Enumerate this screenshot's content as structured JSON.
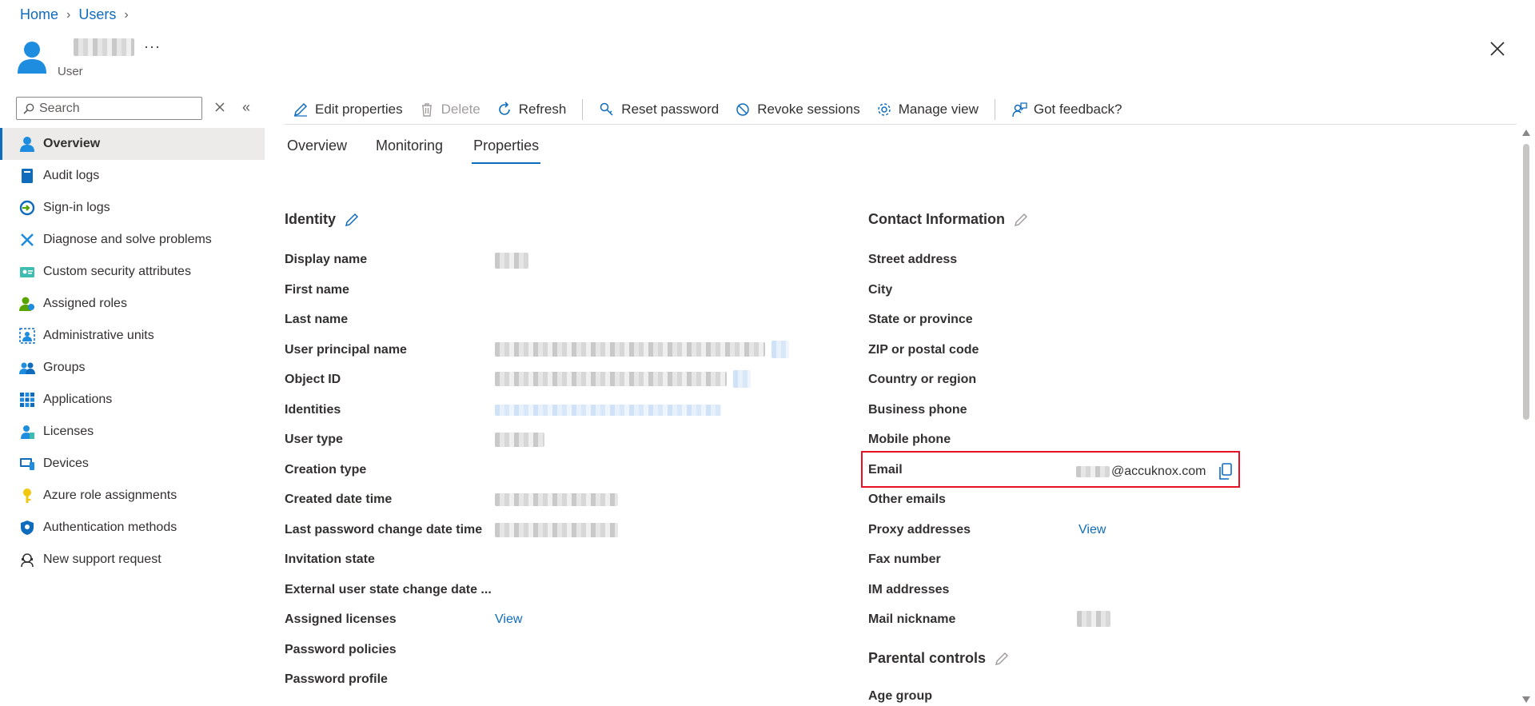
{
  "breadcrumb": {
    "home": "Home",
    "users": "Users"
  },
  "header": {
    "subtitle": "User",
    "more": "···"
  },
  "sidebar": {
    "search_placeholder": "Search",
    "collapse": "«",
    "items": [
      {
        "label": "Overview",
        "icon": "user-icon",
        "active": true
      },
      {
        "label": "Audit logs",
        "icon": "book-icon"
      },
      {
        "label": "Sign-in logs",
        "icon": "sign-in-icon"
      },
      {
        "label": "Diagnose and solve problems",
        "icon": "wrench-icon"
      },
      {
        "label": "Custom security attributes",
        "icon": "attributes-icon"
      },
      {
        "label": "Assigned roles",
        "icon": "roles-icon"
      },
      {
        "label": "Administrative units",
        "icon": "admin-units-icon"
      },
      {
        "label": "Groups",
        "icon": "groups-icon"
      },
      {
        "label": "Applications",
        "icon": "apps-grid-icon"
      },
      {
        "label": "Licenses",
        "icon": "license-icon"
      },
      {
        "label": "Devices",
        "icon": "devices-icon"
      },
      {
        "label": "Azure role assignments",
        "icon": "key-icon"
      },
      {
        "label": "Authentication methods",
        "icon": "shield-icon"
      },
      {
        "label": "New support request",
        "icon": "support-icon"
      }
    ]
  },
  "toolbar": {
    "edit": "Edit properties",
    "delete": "Delete",
    "refresh": "Refresh",
    "reset_password": "Reset password",
    "revoke_sessions": "Revoke sessions",
    "manage_view": "Manage view",
    "feedback": "Got feedback?"
  },
  "tabs": {
    "overview": "Overview",
    "monitoring": "Monitoring",
    "properties": "Properties"
  },
  "identity": {
    "title": "Identity",
    "display_name": "Display name",
    "first_name": "First name",
    "last_name": "Last name",
    "upn": "User principal name",
    "object_id": "Object ID",
    "identities": "Identities",
    "user_type": "User type",
    "creation_type": "Creation type",
    "created": "Created date time",
    "last_pw": "Last password change date time",
    "invitation": "Invitation state",
    "external_state": "External user state change date ...",
    "assigned_licenses": "Assigned licenses",
    "assigned_licenses_value": "View",
    "pw_policies": "Password policies",
    "pw_profile": "Password profile"
  },
  "contact": {
    "title": "Contact Information",
    "street": "Street address",
    "city": "City",
    "state": "State or province",
    "zip": "ZIP or postal code",
    "country": "Country or region",
    "business_phone": "Business phone",
    "mobile_phone": "Mobile phone",
    "email": "Email",
    "email_value": "@accuknox.com",
    "other_emails": "Other emails",
    "proxy": "Proxy addresses",
    "proxy_value": "View",
    "fax": "Fax number",
    "im": "IM addresses",
    "mail_nick": "Mail nickname"
  },
  "parental": {
    "title": "Parental controls",
    "age_group": "Age group"
  },
  "colors": {
    "accent": "#0f6cbd",
    "highlight": "#e81123"
  }
}
